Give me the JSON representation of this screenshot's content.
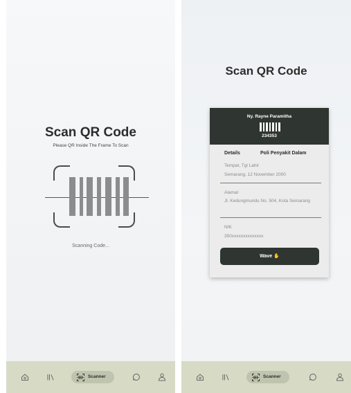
{
  "scanner_screen": {
    "title": "Scan QR Code",
    "subtitle": "Please QR Inside The Frame To Scan",
    "status": "Scanning Code..."
  },
  "result_screen": {
    "title": "Scan QR Code",
    "card": {
      "name": "Ny. Rayne Paramitha",
      "code": "234353",
      "details_label": "Details",
      "department": "Poli Penyakit Dalam",
      "fields": [
        {
          "label": "Tempat, Tgl Lahir",
          "value": "Semarang, 12 November 2000"
        },
        {
          "label": "Alamat",
          "value": "Jl. Kedungmundu No. 504, Kota Semarang"
        },
        {
          "label": "NIK",
          "value": "350xxxxxxxxxxxxxx"
        }
      ],
      "button_label": "Wave"
    }
  },
  "nav": {
    "items": [
      {
        "icon": "home-icon"
      },
      {
        "icon": "library-icon"
      },
      {
        "icon": "scanner-icon",
        "label": "Scanner",
        "active": true
      },
      {
        "icon": "chat-icon"
      },
      {
        "icon": "profile-icon"
      }
    ]
  },
  "colors": {
    "card_header": "#2f3530",
    "nav_bar": "#d7dbc6",
    "nav_active": "#bfc4ae"
  }
}
